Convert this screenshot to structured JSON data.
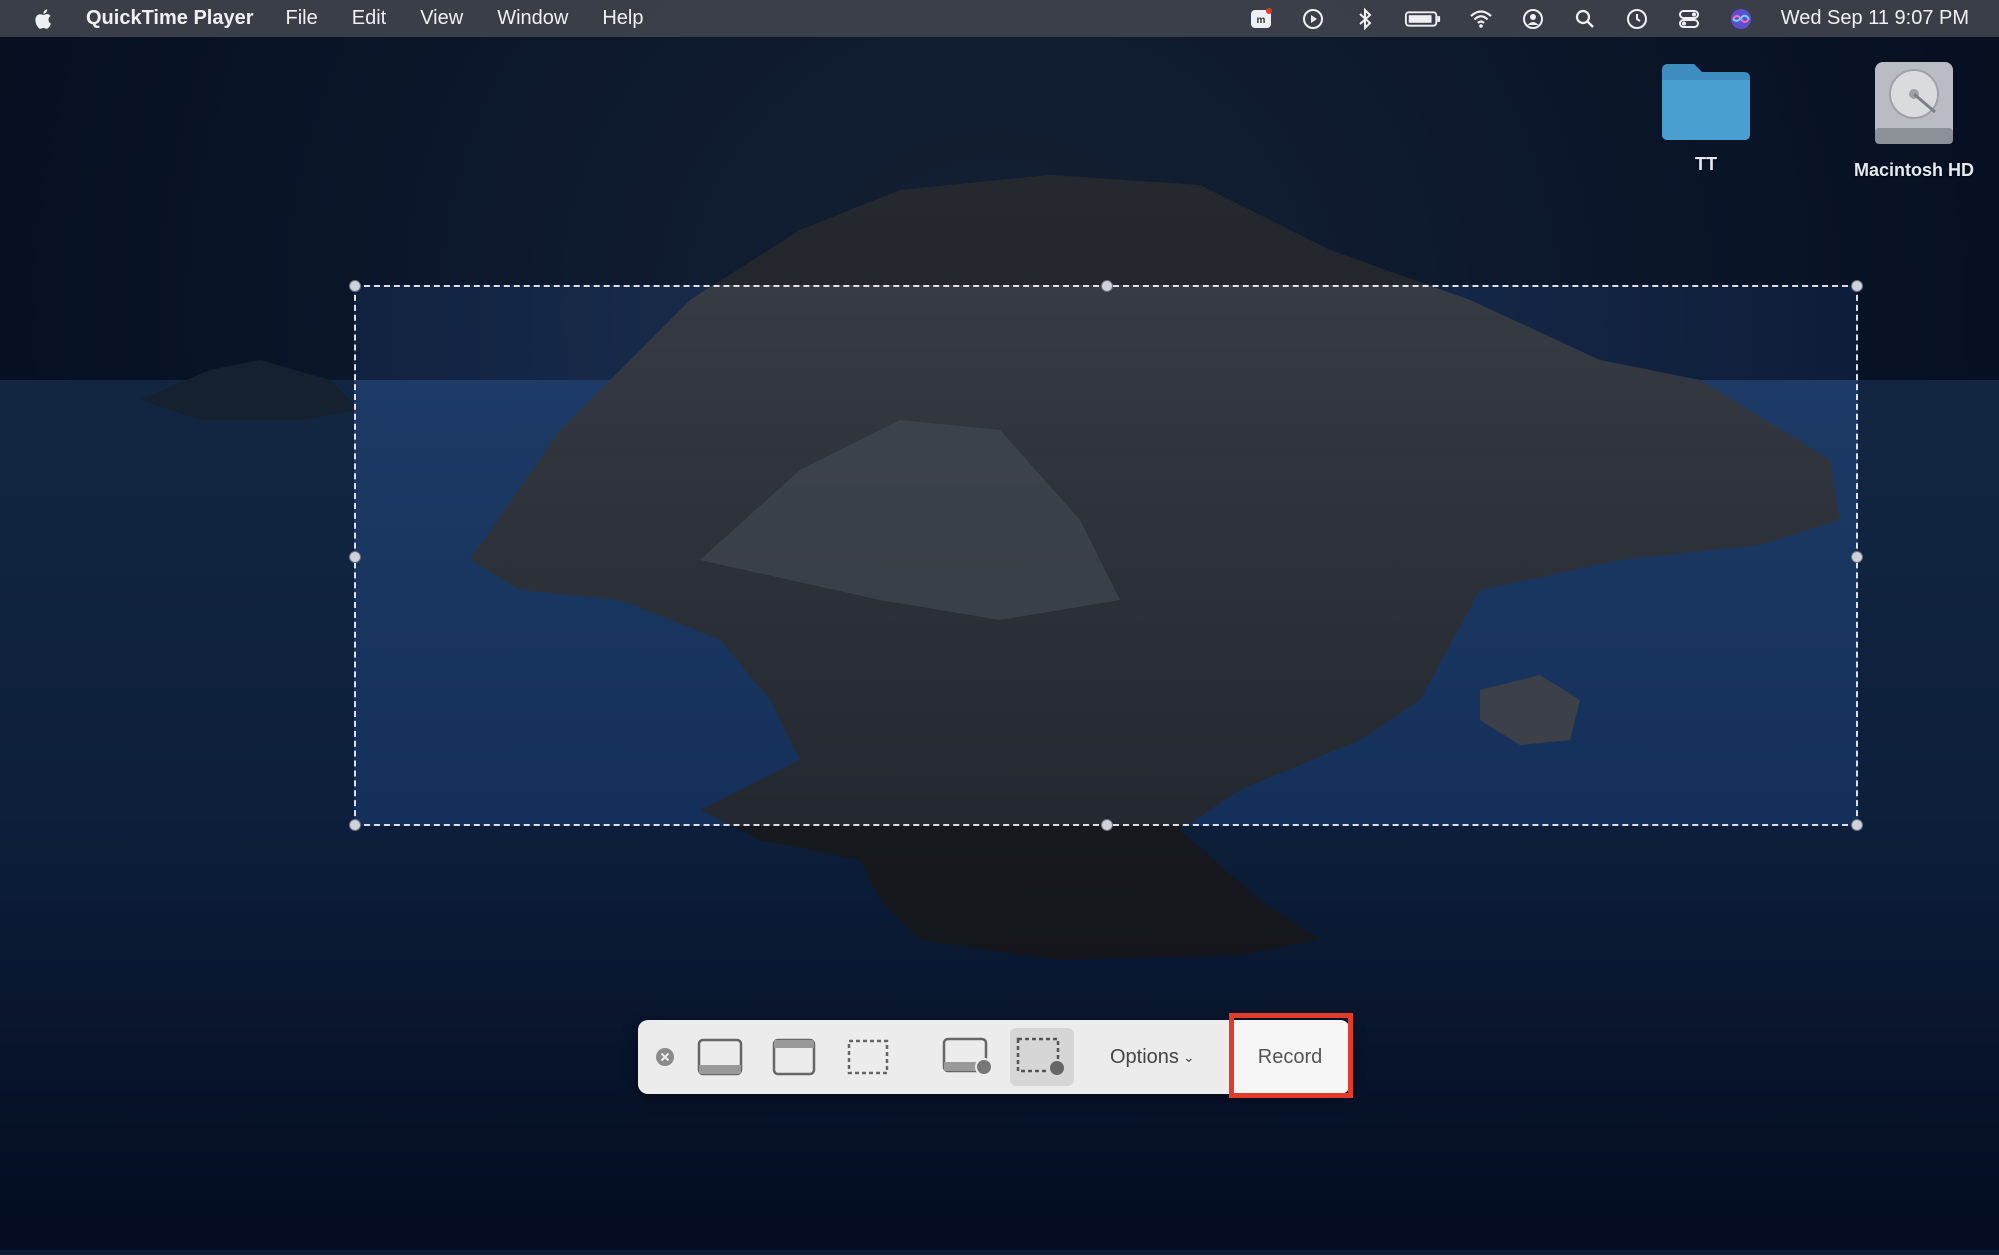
{
  "menubar": {
    "app_name": "QuickTime Player",
    "menus": [
      "File",
      "Edit",
      "View",
      "Window",
      "Help"
    ],
    "clock": "Wed Sep 11  9:07 PM"
  },
  "desktop": {
    "icons": [
      {
        "label": "TT",
        "icon": "folder-icon"
      },
      {
        "label": "Macintosh HD",
        "icon": "hard-drive-icon"
      }
    ]
  },
  "toolbar": {
    "options_label": "Options",
    "record_label": "Record",
    "selected_tool": "record-selected-portion"
  },
  "colors": {
    "highlight": "#e23b2a",
    "folder": "#4a9fd1"
  }
}
